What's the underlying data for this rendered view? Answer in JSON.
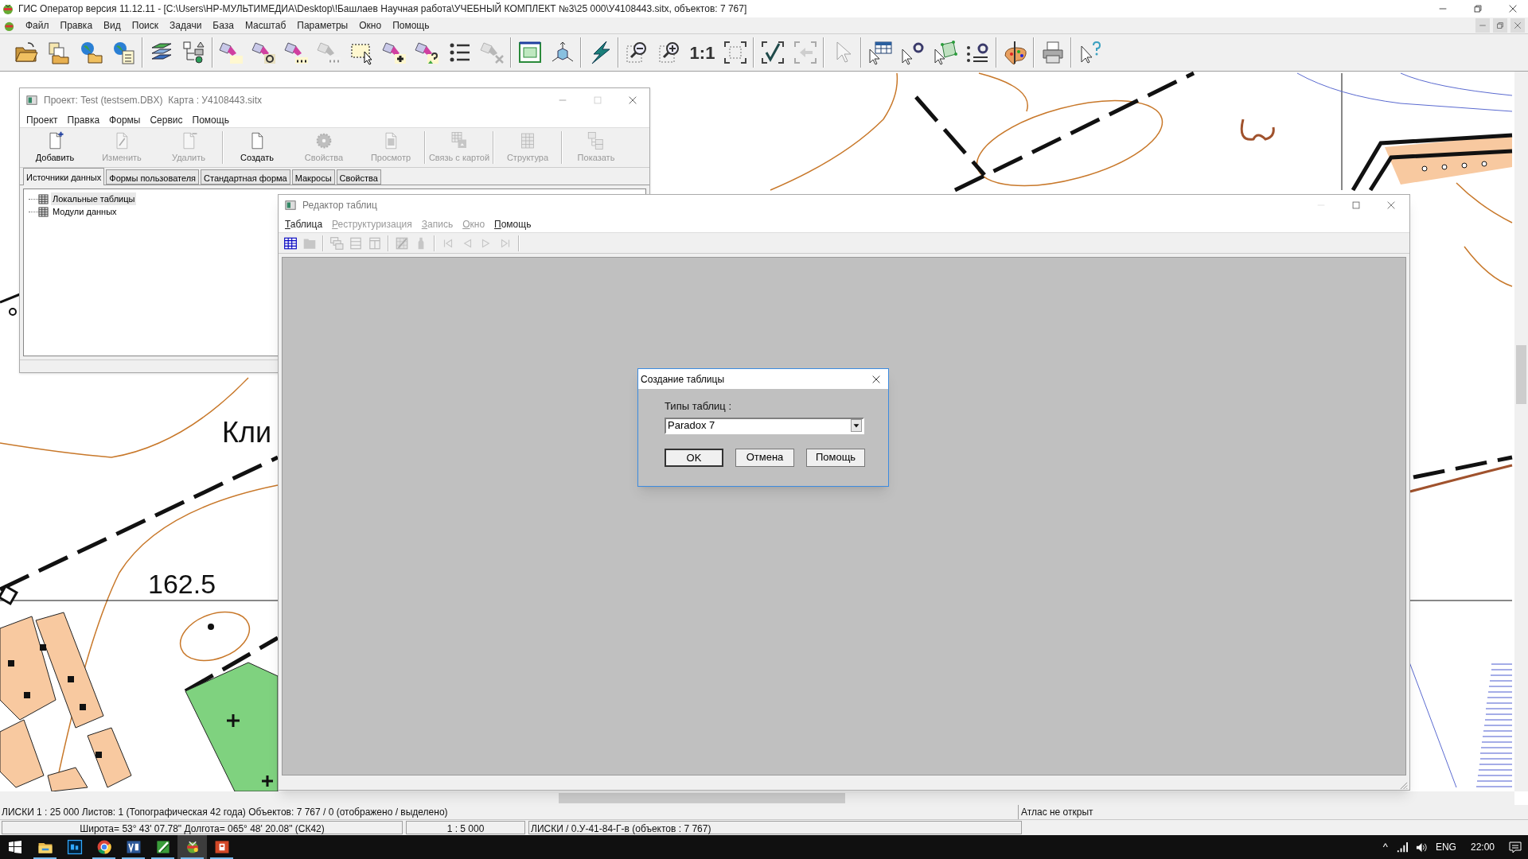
{
  "window": {
    "title": "ГИС Оператор версия 11.12.11 - [C:\\Users\\HP-МУЛЬТИМЕДИА\\Desktop\\!Башлаев Научная работа\\УЧЕБНЫЙ КОМПЛЕКТ №3\\25 000\\У4108443.sitx, объектов: 7 767]"
  },
  "menu": [
    "Файл",
    "Правка",
    "Вид",
    "Поиск",
    "Задачи",
    "База",
    "Масштаб",
    "Параметры",
    "Окно",
    "Помощь"
  ],
  "toolbar": [
    {
      "kind": "folder-open",
      "disabled": false
    },
    {
      "kind": "folders",
      "disabled": false
    },
    {
      "kind": "globe-folder",
      "disabled": false
    },
    {
      "kind": "globe-list",
      "disabled": false
    },
    {
      "kind": "separator"
    },
    {
      "kind": "layers",
      "disabled": false
    },
    {
      "kind": "hierarchy",
      "disabled": false
    },
    {
      "kind": "separator"
    },
    {
      "kind": "flashlight",
      "disabled": false
    },
    {
      "kind": "flashlight-text",
      "disabled": false
    },
    {
      "kind": "flashlight-more",
      "disabled": false
    },
    {
      "kind": "flashlight-more",
      "disabled": true
    },
    {
      "kind": "selection",
      "disabled": false
    },
    {
      "kind": "flashlight-add",
      "disabled": false
    },
    {
      "kind": "flashlight-query",
      "disabled": false
    },
    {
      "kind": "list",
      "disabled": false
    },
    {
      "kind": "flashlight-remove",
      "disabled": true
    },
    {
      "kind": "separator"
    },
    {
      "kind": "frame",
      "disabled": false
    },
    {
      "kind": "cube-arrows",
      "disabled": false
    },
    {
      "kind": "separator"
    },
    {
      "kind": "lightning",
      "disabled": false
    },
    {
      "kind": "separator"
    },
    {
      "kind": "zoom-out",
      "disabled": false
    },
    {
      "kind": "zoom-in",
      "disabled": false
    },
    {
      "kind": "text",
      "label": "1:1",
      "disabled": false
    },
    {
      "kind": "fit",
      "disabled": false
    },
    {
      "kind": "separator"
    },
    {
      "kind": "check",
      "disabled": false
    },
    {
      "kind": "arrow-left",
      "disabled": true
    },
    {
      "kind": "separator"
    },
    {
      "kind": "cursor",
      "disabled": true
    },
    {
      "kind": "separator"
    },
    {
      "kind": "table-cursor",
      "disabled": false
    },
    {
      "kind": "cursor-text",
      "disabled": false
    },
    {
      "kind": "polygon",
      "disabled": false
    },
    {
      "kind": "list-text",
      "disabled": false
    },
    {
      "kind": "separator"
    },
    {
      "kind": "palette",
      "disabled": false
    },
    {
      "kind": "separator"
    },
    {
      "kind": "printer",
      "disabled": false
    },
    {
      "kind": "separator"
    },
    {
      "kind": "help",
      "disabled": false
    }
  ],
  "map": {
    "labels": [
      "Кли",
      "162.5"
    ]
  },
  "project_window": {
    "title": "Проект: Test (testsem.DBX)  Карта : У4108443.sitx",
    "menu": [
      "Проект",
      "Правка",
      "Формы",
      "Сервис",
      "Помощь"
    ],
    "toolbar": [
      {
        "kind": "doc-add",
        "label": "Добавить",
        "disabled": false
      },
      {
        "kind": "doc-edit",
        "label": "Изменить",
        "disabled": true
      },
      {
        "kind": "doc-delete",
        "label": "Удалить",
        "disabled": true
      },
      {
        "kind": "separator"
      },
      {
        "kind": "doc",
        "label": "Создать",
        "disabled": false
      },
      {
        "kind": "gear",
        "label": "Свойства",
        "disabled": true
      },
      {
        "kind": "doc-view",
        "label": "Просмотр",
        "disabled": true
      },
      {
        "kind": "separator"
      },
      {
        "kind": "table-link",
        "label": "Связь с картой",
        "disabled": true
      },
      {
        "kind": "separator"
      },
      {
        "kind": "table",
        "label": "Структура",
        "disabled": true
      },
      {
        "kind": "separator"
      },
      {
        "kind": "table-tree",
        "label": "Показать",
        "disabled": true
      }
    ],
    "tabs": [
      {
        "label": "Источники данных",
        "selected": true
      },
      {
        "label": "Формы пользователя",
        "selected": false
      },
      {
        "label": "Стандартная форма",
        "selected": false
      },
      {
        "label": "Макросы",
        "selected": false
      },
      {
        "label": "Свойства",
        "selected": false
      }
    ],
    "tree": [
      {
        "label": "Локальные таблицы",
        "selected": true
      },
      {
        "label": "Модули данных",
        "selected": false
      }
    ]
  },
  "table_editor": {
    "title": "Редактор таблиц",
    "menu": [
      {
        "label": "Таблица",
        "disabled": false
      },
      {
        "label": "Реструктуризация",
        "disabled": true
      },
      {
        "label": "Запись",
        "disabled": true
      },
      {
        "label": "Окно",
        "disabled": true
      },
      {
        "label": "Помощь",
        "disabled": false
      }
    ],
    "toolbar": [
      {
        "kind": "grid",
        "disabled": false
      },
      {
        "kind": "folder-closed",
        "disabled": true
      },
      {
        "kind": "separator"
      },
      {
        "kind": "windows",
        "disabled": true
      },
      {
        "kind": "split-rows",
        "disabled": true
      },
      {
        "kind": "split-columns",
        "disabled": true
      },
      {
        "kind": "separator"
      },
      {
        "kind": "grid-edit",
        "disabled": true
      },
      {
        "kind": "bottle",
        "disabled": true
      },
      {
        "kind": "separator"
      },
      {
        "kind": "first",
        "disabled": true
      },
      {
        "kind": "prev",
        "disabled": true
      },
      {
        "kind": "next",
        "disabled": true
      },
      {
        "kind": "last",
        "disabled": true
      },
      {
        "kind": "separator"
      }
    ]
  },
  "dialog": {
    "title": "Создание таблицы",
    "label": "Типы таблиц :",
    "value": "Paradox 7",
    "buttons": [
      {
        "label": "OK",
        "default": true
      },
      {
        "label": "Отмена",
        "default": false
      },
      {
        "label": "Помощь",
        "default": false
      }
    ]
  },
  "status_bar": {
    "row1": [
      "ЛИСКИ  1 : 25 000  Листов: 1  (Топографическая 42 года)  Объектов: 7 767 / 0 (отображено / выделено)",
      "Атлас не открыт"
    ],
    "row2": [
      "Широта= 53° 43' 07.78\"    Долгота= 065° 48' 20.08\"  (СК42)",
      "1 : 5 000",
      "ЛИСКИ / 0.У-41-84-Г-в   (объектов : 7 767)"
    ]
  },
  "taskbar": {
    "apps": [
      {
        "kind": "folder",
        "running": true,
        "selected": false
      },
      {
        "kind": "photo",
        "running": false,
        "selected": false
      },
      {
        "kind": "browser",
        "running": true,
        "selected": false
      },
      {
        "kind": "diagram",
        "running": true,
        "selected": false
      },
      {
        "kind": "green",
        "running": true,
        "selected": false
      },
      {
        "kind": "gis",
        "running": true,
        "selected": true
      },
      {
        "kind": "slides",
        "running": true,
        "selected": false
      }
    ],
    "tray_chevron": "^",
    "language": "ENG",
    "time": "22:00"
  }
}
